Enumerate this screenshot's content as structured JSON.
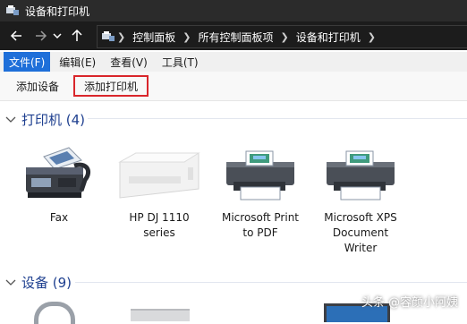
{
  "window": {
    "title": "设备和打印机"
  },
  "breadcrumb": [
    "控制面板",
    "所有控制面板项",
    "设备和打印机"
  ],
  "menu": [
    {
      "label": "文件(F)"
    },
    {
      "label": "编辑(E)"
    },
    {
      "label": "查看(V)"
    },
    {
      "label": "工具(T)"
    }
  ],
  "commands": {
    "add_device": "添加设备",
    "add_printer": "添加打印机"
  },
  "printers_group": {
    "label": "打印机 (4)"
  },
  "printers": [
    {
      "name": "Fax",
      "icon": "fax-icon"
    },
    {
      "name": "HP DJ 1110 series",
      "icon": "inkjet-printer-icon"
    },
    {
      "name": "Microsoft Print to PDF",
      "icon": "printer-icon"
    },
    {
      "name": "Microsoft XPS Document Writer",
      "icon": "printer-icon"
    }
  ],
  "devices_group": {
    "label": "设备 (9)"
  },
  "watermark": "头条 @容颜小阿姨",
  "colors": {
    "title_bar": "#2b2b2b",
    "nav_bar": "#1c1c1c",
    "menu_active": "#1e6fd9",
    "group_header": "#1e3f8f",
    "highlight_border": "#d9262b"
  }
}
